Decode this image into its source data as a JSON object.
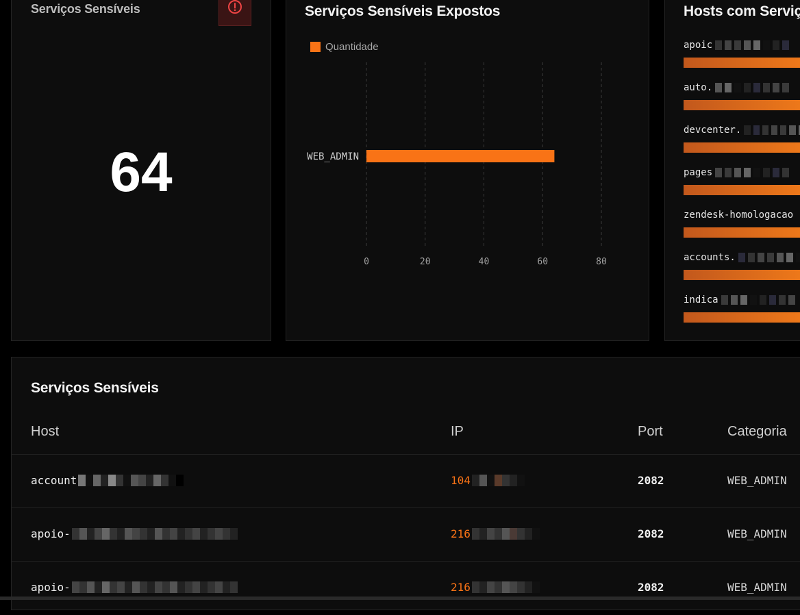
{
  "cards": {
    "count": {
      "title": "Serviços Sensíveis",
      "value": "64",
      "alert_icon": "alert-circle-icon"
    },
    "chart": {
      "title": "Serviços Sensíveis Expostos",
      "legend": "Quantidade"
    },
    "hosts": {
      "title": "Hosts com Serviç",
      "items": [
        {
          "name": "apoic"
        },
        {
          "name": "auto."
        },
        {
          "name": "devcenter."
        },
        {
          "name": "pages"
        },
        {
          "name": "zendesk-homologacao"
        },
        {
          "name": "accounts."
        },
        {
          "name": "indica"
        }
      ]
    }
  },
  "chart_data": {
    "type": "bar",
    "orientation": "horizontal",
    "categories": [
      "WEB_ADMIN"
    ],
    "series": [
      {
        "name": "Quantidade",
        "values": [
          64
        ]
      }
    ],
    "xlim": [
      0,
      80
    ],
    "xticks": [
      0,
      20,
      40,
      60,
      80
    ],
    "grid": "vertical-dashed",
    "legend_position": "top-left",
    "colors": [
      "#f97316"
    ]
  },
  "table": {
    "title": "Serviços Sensíveis",
    "headers": {
      "host": "Host",
      "ip": "IP",
      "port": "Port",
      "category": "Categoria"
    },
    "rows": [
      {
        "host": "account",
        "ip": "104",
        "port": "2082",
        "category": "WEB_ADMIN"
      },
      {
        "host": "apoio-",
        "ip": "216",
        "port": "2082",
        "category": "WEB_ADMIN"
      },
      {
        "host": "apoio-",
        "ip": "216",
        "port": "2082",
        "category": "WEB_ADMIN"
      }
    ]
  },
  "colors": {
    "accent": "#f97316",
    "background": "#0d0d0d",
    "alert": "#ef4444"
  }
}
